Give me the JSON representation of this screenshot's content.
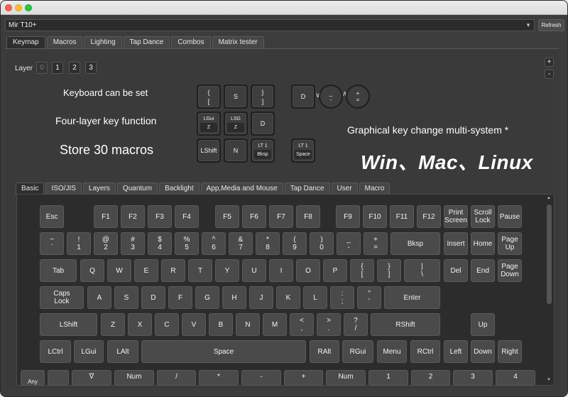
{
  "window": {
    "device_name": "Mir T10+",
    "refresh_label": "Refresh"
  },
  "top_tabs": [
    "Keymap",
    "Macros",
    "Lighting",
    "Tap Dance",
    "Combos",
    "Matrix tester"
  ],
  "layers": {
    "label": "Layer",
    "buttons": [
      "0",
      "1",
      "2",
      "3"
    ],
    "add": "+",
    "remove": "-"
  },
  "promo": {
    "line1": "Keyboard can be set",
    "line2": "Four-layer key function",
    "line3": "Store 30 macros",
    "line4": "Graphical key change multi-system *",
    "line5": "Win、Mac、Linux"
  },
  "overlay_keys": [
    {
      "id": "k1",
      "top": "{",
      "bottom": "["
    },
    {
      "id": "k2",
      "top": "S",
      "bottom": ""
    },
    {
      "id": "k3",
      "top": "}",
      "bottom": "]"
    },
    {
      "id": "k4",
      "top": "LGui",
      "inner": "Z"
    },
    {
      "id": "k5",
      "top": "LSG",
      "inner": "Z"
    },
    {
      "id": "k6",
      "top": "D",
      "bottom": ""
    },
    {
      "id": "k7",
      "top": "LShift",
      "bottom": ""
    },
    {
      "id": "k8",
      "top": "N",
      "bottom": ""
    },
    {
      "id": "k9",
      "top": "LT 1",
      "inner": "Bksp"
    },
    {
      "id": "k10",
      "top": "D",
      "bottom": ""
    },
    {
      "id": "k11",
      "top": "LT 1",
      "inner": "Space"
    }
  ],
  "encoders": [
    {
      "top": "_",
      "bottom": "-"
    },
    {
      "top": "+",
      "bottom": "="
    }
  ],
  "lower_tabs": [
    "Basic",
    "ISO/JIS",
    "Layers",
    "Quantum",
    "Backlight",
    "App,Media and Mouse",
    "Tap Dance",
    "User",
    "Macro"
  ],
  "keys": {
    "esc": "Esc",
    "f1": "F1",
    "f2": "F2",
    "f3": "F3",
    "f4": "F4",
    "f5": "F5",
    "f6": "F6",
    "f7": "F7",
    "f8": "F8",
    "f9": "F9",
    "f10": "F10",
    "f11": "F11",
    "f12": "F12",
    "prtsc": "Print\nScreen",
    "scrlk": "Scroll\nLock",
    "pause": "Pause",
    "grave": "~\n`",
    "n1": "!\n1",
    "n2": "@\n2",
    "n3": "#\n3",
    "n4": "$\n4",
    "n5": "%\n5",
    "n6": "^\n6",
    "n7": "&\n7",
    "n8": "*\n8",
    "n9": "(\n9",
    "n0": ")\n0",
    "minus": "_\n-",
    "equal": "+\n=",
    "bksp": "Bksp",
    "insert": "Insert",
    "home": "Home",
    "pgup": "Page\nUp",
    "tab": "Tab",
    "q": "Q",
    "w": "W",
    "e": "E",
    "r": "R",
    "t": "T",
    "y": "Y",
    "u": "U",
    "i": "I",
    "o": "O",
    "p": "P",
    "lbracket": "{\n[",
    "rbracket": "}\n]",
    "bslash": "|\n\\",
    "del": "Del",
    "end": "End",
    "pgdn": "Page\nDown",
    "caps": "Caps\nLock",
    "a": "A",
    "s": "S",
    "d": "D",
    "f": "F",
    "g": "G",
    "h": "H",
    "j": "J",
    "k": "K",
    "l": "L",
    "semicolon": ":\n;",
    "quote": "\"\n'",
    "enter": "Enter",
    "lshift": "LShift",
    "z": "Z",
    "x": "X",
    "c": "C",
    "v": "V",
    "b": "B",
    "n": "N",
    "m": "M",
    "comma": "<\n,",
    "period": ">\n.",
    "slash": "?\n/",
    "rshift": "RShift",
    "up": "Up",
    "lctrl": "LCtrl",
    "lgui": "LGui",
    "lalt": "LAlt",
    "space": "Space",
    "ralt": "RAlt",
    "rgui": "RGui",
    "menu": "Menu",
    "rctrl": "RCtrl",
    "left": "Left",
    "down": "Down",
    "right": "Right",
    "any": "Any",
    "blank": "",
    "trans": "∇",
    "numlk": "Num",
    "kp_slash": "/",
    "kp_star": "*",
    "kp_minus": "-",
    "kp_plus": "+",
    "kp_num": "Num",
    "kp1": "1",
    "kp2": "2",
    "kp3": "3",
    "kp4": "4"
  }
}
